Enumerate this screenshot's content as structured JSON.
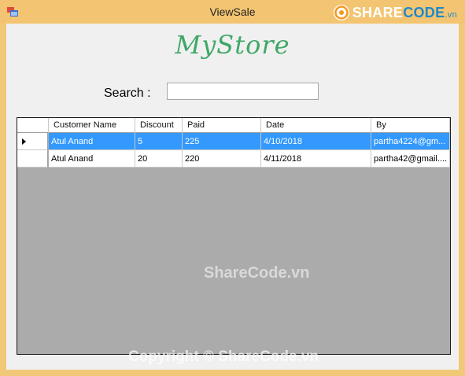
{
  "window": {
    "title": "ViewSale"
  },
  "logo": {
    "share": "SHARE",
    "code": "CODE",
    "vn": ".vn"
  },
  "brand": "MyStore",
  "search": {
    "label": "Search :",
    "value": ""
  },
  "grid": {
    "columns": [
      "Customer Name",
      "Discount",
      "Paid",
      "Date",
      "By"
    ],
    "rows": [
      {
        "name": "Atul Anand",
        "discount": "5",
        "paid": "225",
        "date": "4/10/2018",
        "by": "partha4224@gm...",
        "selected": true
      },
      {
        "name": "Atul Anand",
        "discount": "20",
        "paid": "220",
        "date": "4/11/2018",
        "by": "partha42@gmail....",
        "selected": false
      }
    ]
  },
  "watermarks": {
    "center": "ShareCode.vn",
    "bottom": "Copyright © ShareCode.vn"
  },
  "colors": {
    "titlebar": "#f3c572",
    "selection": "#3399ff",
    "brand": "#3fa867",
    "grid_bg": "#ababab"
  }
}
